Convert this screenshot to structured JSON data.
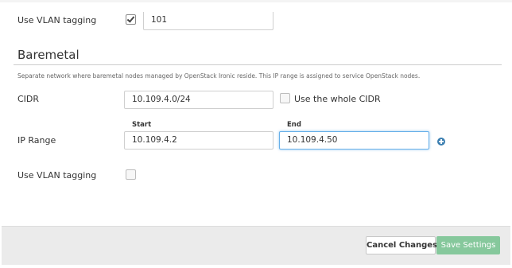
{
  "vlan_top": {
    "label": "Use VLAN tagging",
    "checked": true,
    "value": "101"
  },
  "baremetal": {
    "title": "Baremetal",
    "description": "Separate network where baremetal nodes managed by OpenStack Ironic reside. This IP range is assigned to service OpenStack nodes.",
    "cidr": {
      "label": "CIDR",
      "value": "10.109.4.0/24",
      "whole_cidr_label": "Use the whole CIDR",
      "whole_cidr_checked": false
    },
    "ip_range": {
      "label": "IP Range",
      "start_header": "Start",
      "end_header": "End",
      "start_value": "10.109.4.2",
      "end_value": "10.109.4.50",
      "add_icon": "plus-circle-icon"
    },
    "vlan": {
      "label": "Use VLAN tagging",
      "checked": false
    }
  },
  "footer": {
    "cancel_label": "Cancel Changes",
    "save_label": "Save Settings"
  },
  "colors": {
    "save_button": "#86c89c",
    "focus_border": "#66afe9",
    "add_icon": "#3c7fb1"
  }
}
